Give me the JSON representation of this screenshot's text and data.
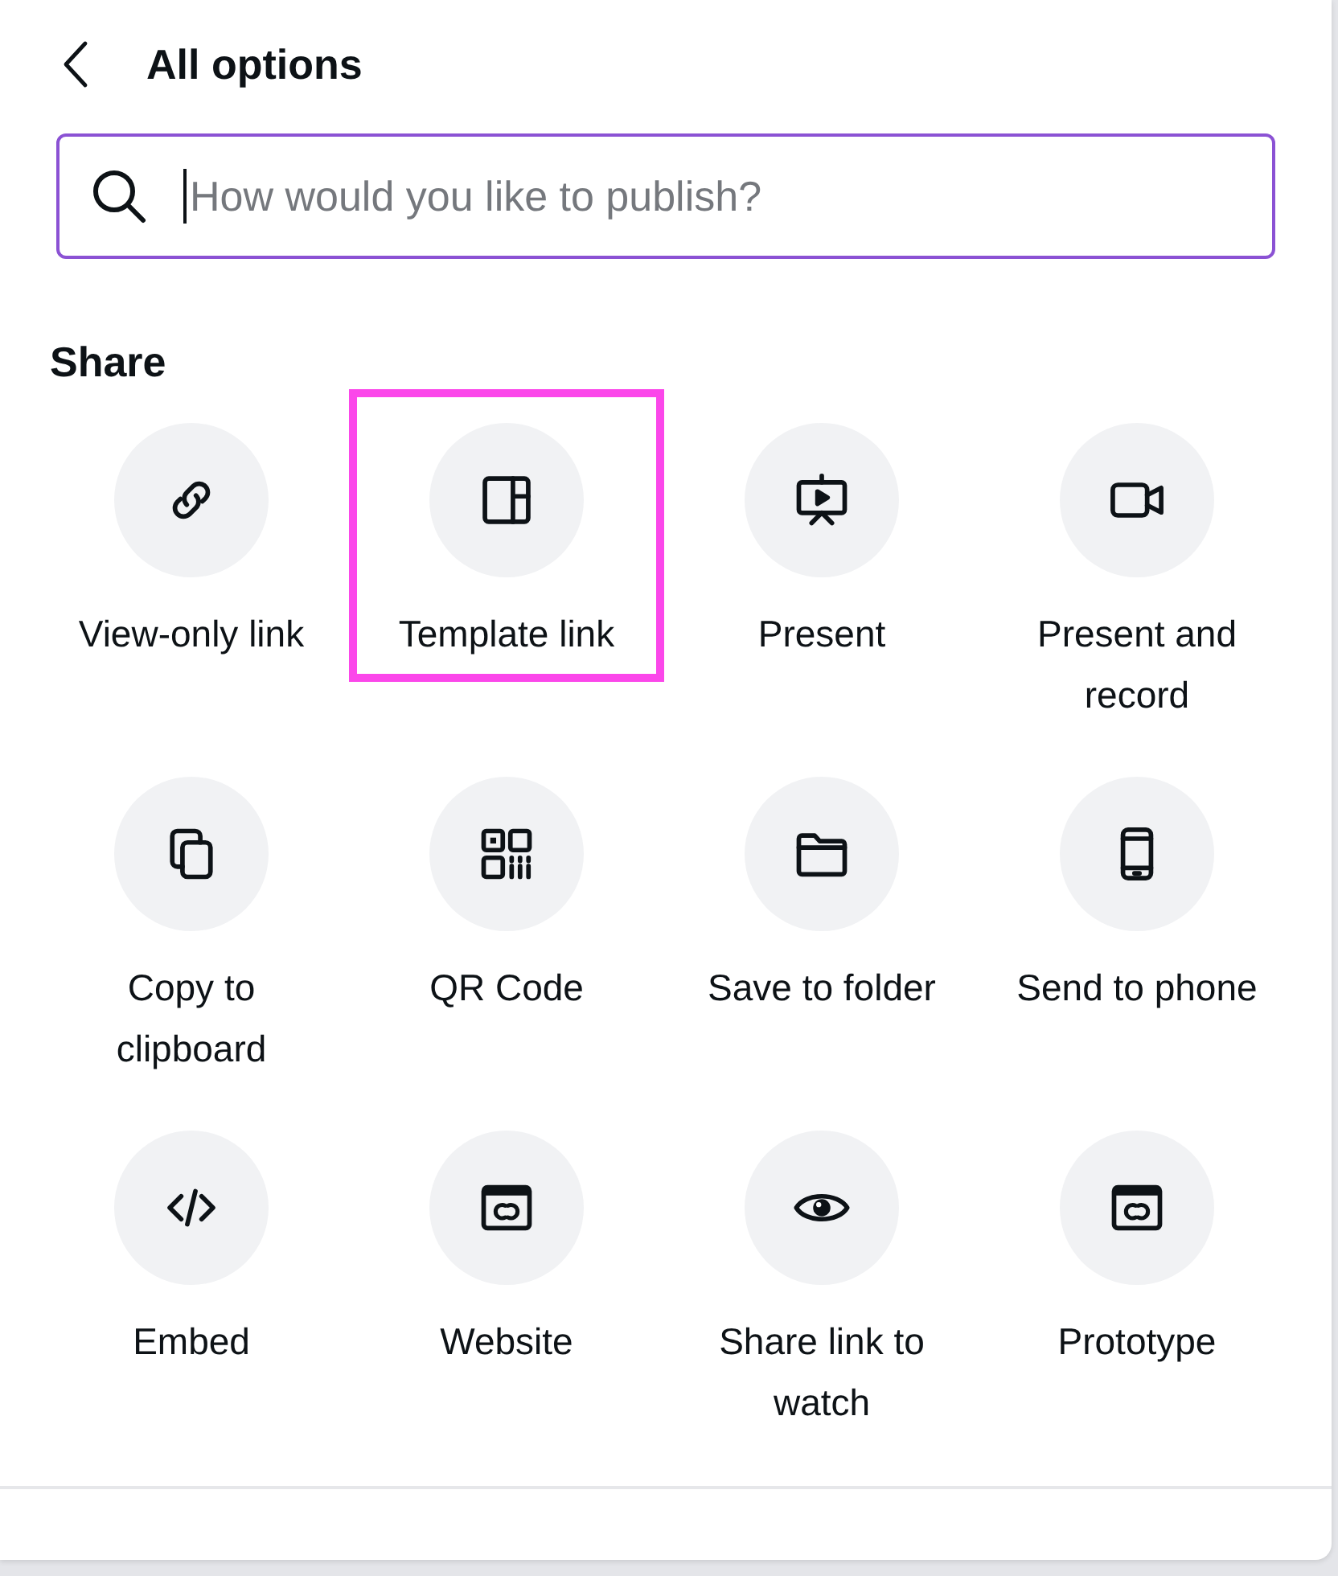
{
  "header": {
    "title": "All options"
  },
  "search": {
    "placeholder": "How would you like to publish?",
    "focused": true
  },
  "section": {
    "title": "Share",
    "items": [
      {
        "label": "View-only link",
        "kind": "link",
        "highlighted": false
      },
      {
        "label": "Template link",
        "kind": "template",
        "highlighted": true
      },
      {
        "label": "Present",
        "kind": "present",
        "highlighted": false
      },
      {
        "label": "Present and record",
        "kind": "record",
        "highlighted": false
      },
      {
        "label": "Copy to clipboard",
        "kind": "copy",
        "highlighted": false
      },
      {
        "label": "QR Code",
        "kind": "qr",
        "highlighted": false
      },
      {
        "label": "Save to folder",
        "kind": "folder",
        "highlighted": false
      },
      {
        "label": "Send to phone",
        "kind": "phone",
        "highlighted": false
      },
      {
        "label": "Embed",
        "kind": "embed",
        "highlighted": false
      },
      {
        "label": "Website",
        "kind": "website",
        "highlighted": false
      },
      {
        "label": "Share link to watch",
        "kind": "watch",
        "highlighted": false
      },
      {
        "label": "Prototype",
        "kind": "prototype",
        "highlighted": false
      }
    ]
  }
}
